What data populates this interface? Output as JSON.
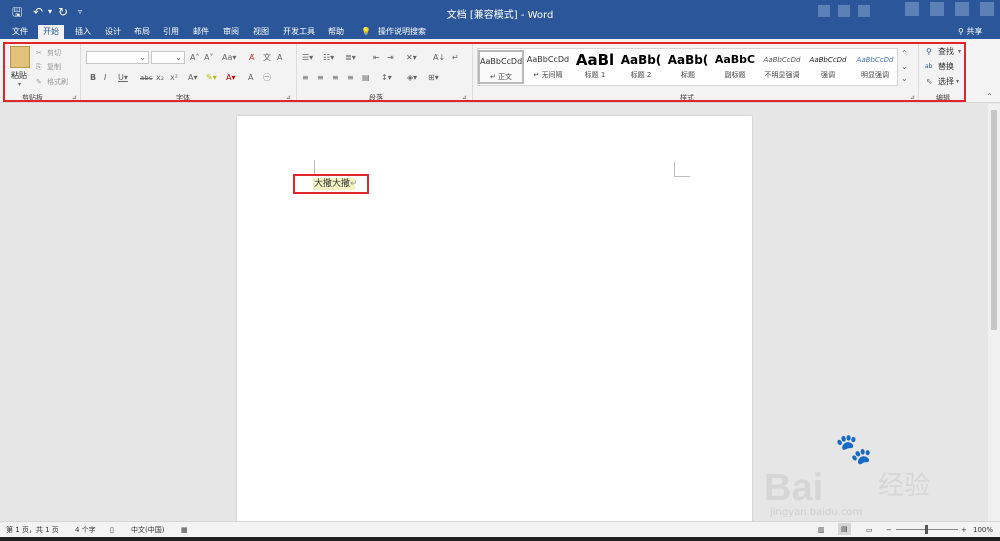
{
  "titlebar": {
    "title": "文档 [兼容模式] - Word",
    "quick_access": [
      "save-icon",
      "undo-icon",
      "redo-icon",
      "customize-icon"
    ]
  },
  "tabs": [
    {
      "label": "文件"
    },
    {
      "label": "开始",
      "active": true
    },
    {
      "label": "插入"
    },
    {
      "label": "设计"
    },
    {
      "label": "布局"
    },
    {
      "label": "引用"
    },
    {
      "label": "邮件"
    },
    {
      "label": "审阅"
    },
    {
      "label": "视图"
    },
    {
      "label": "开发工具"
    },
    {
      "label": "帮助"
    },
    {
      "label": "操作说明搜索"
    }
  ],
  "share_label": "共享",
  "ribbon": {
    "clipboard": {
      "paste": "粘贴",
      "cut": "剪切",
      "copy": "复制",
      "format_painter": "格式刷",
      "group": "剪贴板"
    },
    "font": {
      "group": "字体",
      "font_name": "",
      "font_size": ""
    },
    "paragraph": {
      "group": "段落"
    },
    "styles": {
      "group": "样式",
      "items": [
        {
          "preview": "AaBbCcDd",
          "name": "↵ 正文"
        },
        {
          "preview": "AaBbCcDd",
          "name": "↵ 无间隔"
        },
        {
          "preview": "AaBl",
          "name": "标题 1"
        },
        {
          "preview": "AaBb(",
          "name": "标题 2"
        },
        {
          "preview": "AaBb(",
          "name": "标题"
        },
        {
          "preview": "AaBbC",
          "name": "副标题"
        },
        {
          "preview": "AaBbCcDd",
          "name": "不明显强调"
        },
        {
          "preview": "AaBbCcDd",
          "name": "强调"
        },
        {
          "preview": "AaBbCcDd",
          "name": "明显强调"
        }
      ]
    },
    "editing": {
      "find": "查找",
      "replace": "替换",
      "select": "选择",
      "group": "编辑"
    }
  },
  "document": {
    "text": "大撒大撒",
    "paragraph_mark": "↵"
  },
  "statusbar": {
    "page": "第 1 页，共 1 页",
    "words": "4 个字",
    "language": "中文(中国)",
    "zoom": "100%"
  },
  "watermark": {
    "logo": "Bai",
    "brand": "经验",
    "url": "jingyan.baidu.com"
  },
  "colors": {
    "titlebar": "#2b579a",
    "highlight_box": "#e0262b"
  }
}
